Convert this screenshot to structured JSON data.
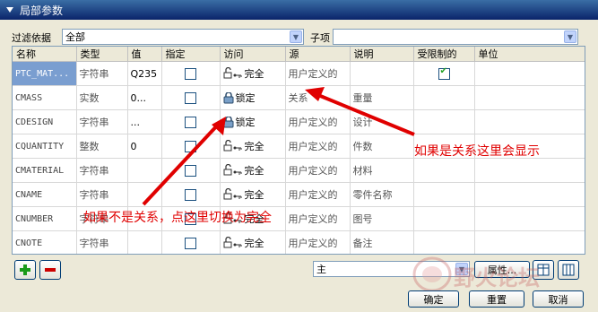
{
  "window": {
    "title": "局部参数"
  },
  "filter": {
    "label": "过滤依据",
    "value": "全部",
    "sub_label": "子项",
    "sub_value": ""
  },
  "columns": [
    "名称",
    "类型",
    "值",
    "指定",
    "访问",
    "源",
    "说明",
    "受限制的",
    "单位"
  ],
  "rows": [
    {
      "name": "PTC_MAT...",
      "type": "字符串",
      "value": "Q235",
      "assigned": false,
      "access": "完全",
      "access_icon": "unlock-icon",
      "source": "用户定义的",
      "desc": "",
      "restricted": true,
      "unit": ""
    },
    {
      "name": "CMASS",
      "type": "实数",
      "value": "0...",
      "assigned": false,
      "access": "锁定",
      "access_icon": "lock-icon",
      "source": "关系",
      "desc": "重量",
      "restricted": false,
      "unit": ""
    },
    {
      "name": "CDESIGN",
      "type": "字符串",
      "value": "...",
      "assigned": false,
      "access": "锁定",
      "access_icon": "lock-icon",
      "source": "用户定义的",
      "desc": "设计",
      "restricted": false,
      "unit": ""
    },
    {
      "name": "CQUANTITY",
      "type": "整数",
      "value": "0",
      "assigned": false,
      "access": "完全",
      "access_icon": "unlock-icon",
      "source": "用户定义的",
      "desc": "件数",
      "restricted": false,
      "unit": ""
    },
    {
      "name": "CMATERIAL",
      "type": "字符串",
      "value": "",
      "assigned": false,
      "access": "完全",
      "access_icon": "unlock-icon",
      "source": "用户定义的",
      "desc": "材料",
      "restricted": false,
      "unit": ""
    },
    {
      "name": "CNAME",
      "type": "字符串",
      "value": "",
      "assigned": false,
      "access": "完全",
      "access_icon": "unlock-icon",
      "source": "用户定义的",
      "desc": "零件名称",
      "restricted": false,
      "unit": ""
    },
    {
      "name": "CNUMBER",
      "type": "字符串",
      "value": "",
      "assigned": false,
      "access": "完全",
      "access_icon": "unlock-icon",
      "source": "用户定义的",
      "desc": "图号",
      "restricted": false,
      "unit": ""
    },
    {
      "name": "CNOTE",
      "type": "字符串",
      "value": "",
      "assigned": false,
      "access": "完全",
      "access_icon": "unlock-icon",
      "source": "用户定义的",
      "desc": "备注",
      "restricted": false,
      "unit": ""
    }
  ],
  "annotations": {
    "right": "如果是关系这里会显示",
    "left": "如果不是关系，点这里切换为完全"
  },
  "bottom": {
    "main_value": "主",
    "properties_label": "属性...",
    "ok": "确定",
    "reset": "重置",
    "cancel": "取消"
  },
  "watermark": "野火论坛",
  "colors": {
    "title_bar": "#0a246a",
    "annotation": "#e00000",
    "add": "#1a9a1a",
    "remove": "#cc0000"
  }
}
